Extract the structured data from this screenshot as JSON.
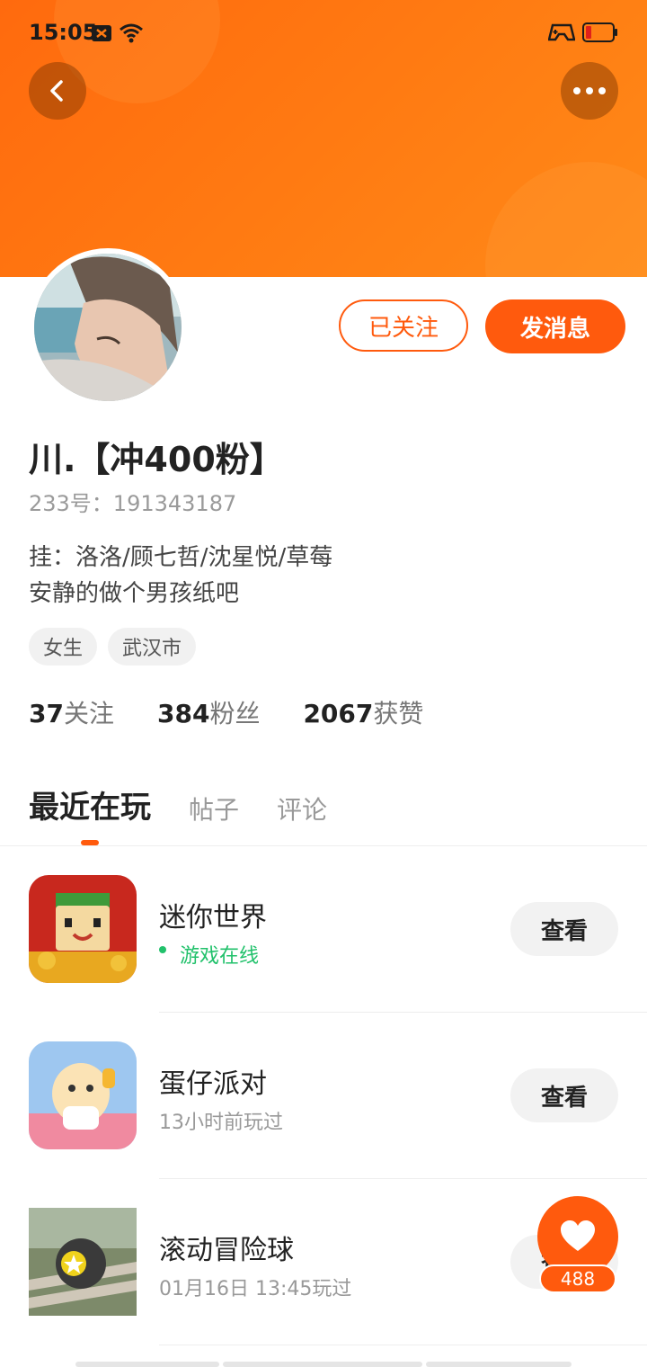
{
  "status_bar": {
    "time": "15:05"
  },
  "profile": {
    "name": "川.【冲400粉】",
    "id_label": "233号：191343187",
    "bio_line1": "挂：洛洛/顾七哲/沈星悦/草莓",
    "bio_line2": "安静的做个男孩纸吧",
    "tags": [
      "女生",
      "武汉市"
    ],
    "following_count": "37",
    "following_label": "关注",
    "fans_count": "384",
    "fans_label": "粉丝",
    "likes_count": "2067",
    "likes_label": "获赞"
  },
  "actions": {
    "follow_label": "已关注",
    "message_label": "发消息"
  },
  "tabs": [
    {
      "label": "最近在玩"
    },
    {
      "label": "帖子"
    },
    {
      "label": "评论"
    }
  ],
  "games": [
    {
      "title": "迷你世界",
      "subtitle": "游戏在线",
      "button": "查看"
    },
    {
      "title": "蛋仔派对",
      "subtitle": "13小时前玩过",
      "button": "查看"
    },
    {
      "title": "滚动冒险球",
      "subtitle": "01月16日 13:45玩过",
      "button": "查看"
    }
  ],
  "fab": {
    "count": "488",
    "icon": "heart-icon"
  },
  "colors": {
    "accent": "#ff5a0d",
    "online": "#21c16b"
  }
}
